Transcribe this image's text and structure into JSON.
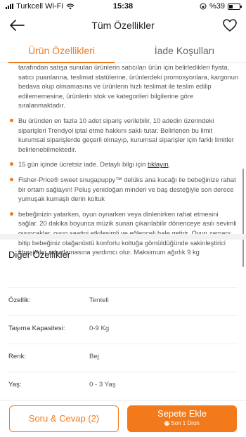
{
  "status": {
    "carrier": "Turkcell Wi-Fi",
    "time": "15:38",
    "battery": "%39"
  },
  "header": {
    "title": "Tüm Özellikler",
    "back_icon": "arrow-left-icon",
    "favorite_icon": "heart-icon"
  },
  "tabs": [
    {
      "label": "Ürün Özellikleri",
      "active": true
    },
    {
      "label": "İade Koşulları",
      "active": false
    }
  ],
  "bullets": [
    {
      "text": "tarafından satışa sunulan ürünlerin satıcıları ürün için belirledikleri fiyata, satıcı puanlarına, teslimat statülerine, ürünlerdeki promosyonlara, kargonun bedava olup olmamasına ve ürünlerin hızlı teslimat ile teslim edilip edilememesine, ürünlerin stok ve kategorileri bilgilerine göre sıralanmaktadır."
    },
    {
      "text": "Bu üründen en fazla 10 adet sipariş verilebilir, 10 adedin üzerindeki siparişleri Trendyol iptal etme hakkını saklı tutar. Belirlenen bu limit kurumsal siparişlerde geçerli olmayıp, kurumsal siparişler için farklı limitler belirlenebilmektedir."
    },
    {
      "text": "15 gün içinde ücretsiz iade. Detaylı bilgi için ",
      "link": "tıklayın",
      "suffix": "."
    },
    {
      "text": "Fisher-Price® sweet snugapuppy™ delüks ana kucağı ile bebeğinize rahat bir ortam sağlayın! Peluş yenidoğan minderi ve baş desteğiyle son derece yumuşak kumaşlı derin koltuk"
    },
    {
      "text": "bebeğinizin yatarken, oyun oynarken veya dinlenirken rahat etmesini sağlar. 20 dakika boyunca müzik sunan çıkarılabilir dönenceye asılı sevimli oyuncaklar, oyun saatini etkileşimli ve eğlenceli hale getirir. Oyun zamanı bitip bebeğiniz olağanüstü konforlu koltuğa gömüldüğünde sakinleştirici titreşimler rahatlamasına yardımcı olur. Maksimum ağırlık 9 kg"
    }
  ],
  "other": {
    "title": "Diğer Özellikler",
    "rows": [
      {
        "key": "Özellik:",
        "value": "Tenteli"
      },
      {
        "key": "Taşıma Kapasitesi:",
        "value": "0-9 Kg"
      },
      {
        "key": "Renk:",
        "value": "Bej"
      },
      {
        "key": "Yaş:",
        "value": "0 - 3 Yaş"
      }
    ]
  },
  "actions": {
    "qa_label": "Soru & Cevap (2)",
    "cart_label": "Sepete Ekle",
    "cart_sub": "Son 1 Ürün"
  },
  "colors": {
    "accent": "#f27a1a"
  }
}
